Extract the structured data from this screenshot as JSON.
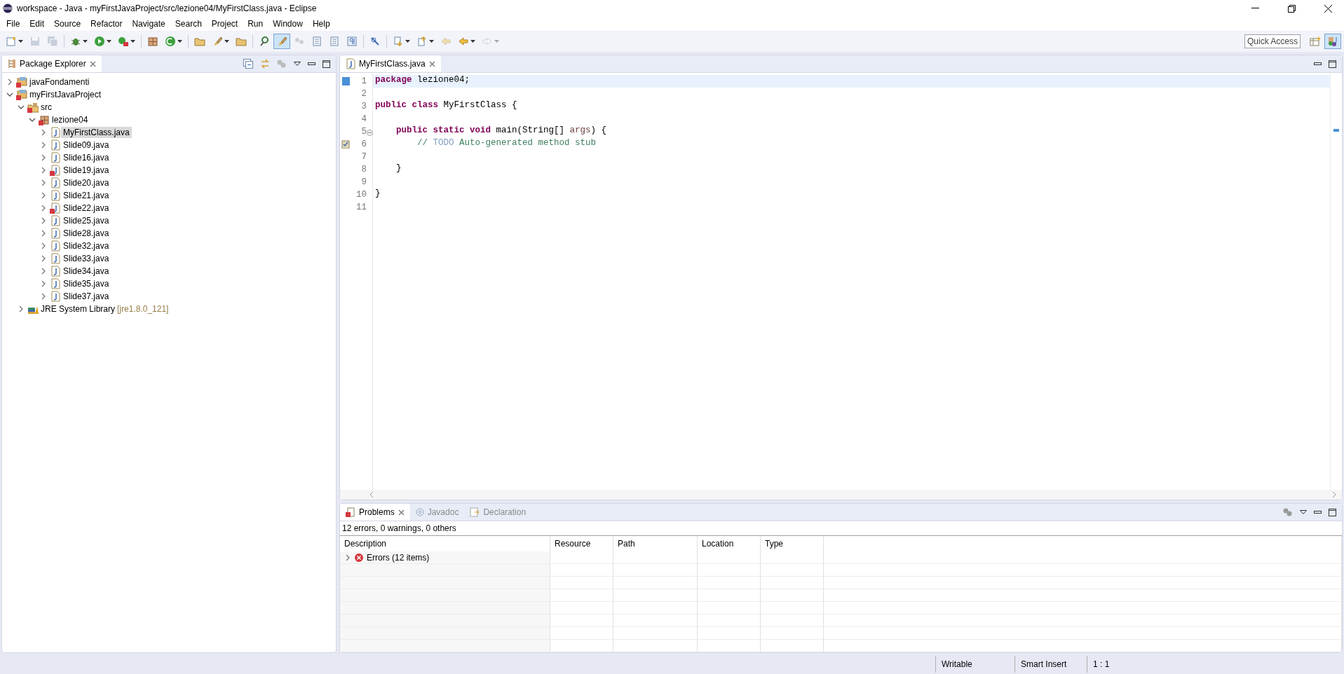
{
  "window": {
    "title": "workspace - Java - myFirstJavaProject/src/lezione04/MyFirstClass.java - Eclipse"
  },
  "menu": [
    "File",
    "Edit",
    "Source",
    "Refactor",
    "Navigate",
    "Search",
    "Project",
    "Run",
    "Window",
    "Help"
  ],
  "toolbar": [
    {
      "kind": "new",
      "dropdown": true,
      "selected": false,
      "disabled": false
    },
    {
      "kind": "save",
      "dropdown": false,
      "selected": false,
      "disabled": true
    },
    {
      "kind": "saveall",
      "dropdown": false,
      "selected": false,
      "disabled": true
    },
    {
      "kind": "sep"
    },
    {
      "kind": "bug",
      "dropdown": true,
      "selected": false,
      "disabled": false
    },
    {
      "kind": "run",
      "dropdown": true,
      "selected": false,
      "disabled": false
    },
    {
      "kind": "external",
      "dropdown": true,
      "selected": false,
      "disabled": false
    },
    {
      "kind": "sep"
    },
    {
      "kind": "package",
      "dropdown": false,
      "selected": false,
      "disabled": false
    },
    {
      "kind": "newclass",
      "dropdown": true,
      "selected": false,
      "disabled": false
    },
    {
      "kind": "sep"
    },
    {
      "kind": "folder",
      "dropdown": false,
      "selected": false,
      "disabled": false
    },
    {
      "kind": "brush",
      "dropdown": true,
      "selected": false,
      "disabled": false
    },
    {
      "kind": "folder",
      "dropdown": false,
      "selected": false,
      "disabled": false
    },
    {
      "kind": "sep"
    },
    {
      "kind": "search",
      "dropdown": false,
      "selected": false,
      "disabled": false
    },
    {
      "kind": "brush",
      "dropdown": false,
      "selected": true,
      "disabled": false
    },
    {
      "kind": "dots",
      "dropdown": false,
      "selected": false,
      "disabled": true
    },
    {
      "kind": "doc",
      "dropdown": false,
      "selected": false,
      "disabled": false
    },
    {
      "kind": "doc",
      "dropdown": false,
      "selected": false,
      "disabled": false
    },
    {
      "kind": "para",
      "dropdown": false,
      "selected": false,
      "disabled": false
    },
    {
      "kind": "sep"
    },
    {
      "kind": "pin",
      "dropdown": false,
      "selected": false,
      "disabled": false
    },
    {
      "kind": "sep"
    },
    {
      "kind": "down",
      "dropdown": true,
      "selected": false,
      "disabled": false
    },
    {
      "kind": "up",
      "dropdown": true,
      "selected": false,
      "disabled": false
    },
    {
      "kind": "back",
      "dropdown": false,
      "selected": false,
      "disabled": true
    },
    {
      "kind": "back",
      "dropdown": true,
      "selected": false,
      "disabled": false
    },
    {
      "kind": "forward",
      "dropdown": true,
      "selected": false,
      "disabled": true
    }
  ],
  "quick_access": {
    "placeholder": "Quick Access"
  },
  "perspectives": [
    {
      "kind": "open",
      "selected": false
    },
    {
      "kind": "java",
      "selected": true
    }
  ],
  "package_explorer": {
    "title": "Package Explorer",
    "tree": [
      {
        "kind": "project",
        "label": "javaFondamenti",
        "error": true,
        "expanded": false,
        "selected": false
      },
      {
        "kind": "project",
        "label": "myFirstJavaProject",
        "error": true,
        "expanded": true,
        "selected": false,
        "children": [
          {
            "kind": "folder",
            "label": "src",
            "error": true,
            "expanded": true,
            "selected": false,
            "children": [
              {
                "kind": "package",
                "label": "lezione04",
                "error": true,
                "expanded": true,
                "selected": false,
                "children": [
                  {
                    "kind": "file",
                    "label": "MyFirstClass.java",
                    "error": false,
                    "expanded": false,
                    "selected": true
                  },
                  {
                    "kind": "file",
                    "label": "Slide09.java",
                    "error": false,
                    "expanded": false,
                    "selected": false
                  },
                  {
                    "kind": "file",
                    "label": "Slide16.java",
                    "error": false,
                    "expanded": false,
                    "selected": false
                  },
                  {
                    "kind": "file",
                    "label": "Slide19.java",
                    "error": true,
                    "expanded": false,
                    "selected": false
                  },
                  {
                    "kind": "file",
                    "label": "Slide20.java",
                    "error": false,
                    "expanded": false,
                    "selected": false
                  },
                  {
                    "kind": "file",
                    "label": "Slide21.java",
                    "error": false,
                    "expanded": false,
                    "selected": false
                  },
                  {
                    "kind": "file",
                    "label": "Slide22.java",
                    "error": true,
                    "expanded": false,
                    "selected": false
                  },
                  {
                    "kind": "file",
                    "label": "Slide25.java",
                    "error": false,
                    "expanded": false,
                    "selected": false
                  },
                  {
                    "kind": "file",
                    "label": "Slide28.java",
                    "error": false,
                    "expanded": false,
                    "selected": false
                  },
                  {
                    "kind": "file",
                    "label": "Slide32.java",
                    "error": false,
                    "expanded": false,
                    "selected": false
                  },
                  {
                    "kind": "file",
                    "label": "Slide33.java",
                    "error": false,
                    "expanded": false,
                    "selected": false
                  },
                  {
                    "kind": "file",
                    "label": "Slide34.java",
                    "error": false,
                    "expanded": false,
                    "selected": false
                  },
                  {
                    "kind": "file",
                    "label": "Slide35.java",
                    "error": false,
                    "expanded": false,
                    "selected": false
                  },
                  {
                    "kind": "file",
                    "label": "Slide37.java",
                    "error": false,
                    "expanded": false,
                    "selected": false
                  }
                ]
              }
            ]
          },
          {
            "kind": "library",
            "label": "JRE System Library",
            "decoration": "[jre1.8.0_121]",
            "error": false,
            "expanded": false,
            "selected": false
          }
        ]
      }
    ]
  },
  "editor": {
    "tab": "MyFirstClass.java",
    "lines": [
      {
        "number": "1",
        "bookmark": true,
        "task": false,
        "foldable": false,
        "current": true,
        "tokens": [
          {
            "kind": "keyword",
            "text": "package"
          },
          {
            "kind": "plain",
            "text": " lezione04;"
          }
        ]
      },
      {
        "number": "2",
        "bookmark": false,
        "task": false,
        "foldable": false,
        "current": false
      },
      {
        "number": "3",
        "bookmark": false,
        "task": false,
        "foldable": false,
        "current": false,
        "tokens": [
          {
            "kind": "keyword",
            "text": "public"
          },
          {
            "kind": "keyword",
            "text": " class"
          },
          {
            "kind": "plain",
            "text": " MyFirstClass {"
          }
        ]
      },
      {
        "number": "4",
        "bookmark": false,
        "task": false,
        "foldable": false,
        "current": false
      },
      {
        "number": "5",
        "bookmark": false,
        "task": false,
        "foldable": true,
        "current": false,
        "tokens": [
          {
            "kind": "keyword",
            "text": "    public"
          },
          {
            "kind": "keyword",
            "text": " static"
          },
          {
            "kind": "keyword",
            "text": " void"
          },
          {
            "kind": "plain",
            "text": " main(String[] "
          },
          {
            "kind": "param",
            "text": "args"
          },
          {
            "kind": "plain",
            "text": ") {"
          }
        ]
      },
      {
        "number": "6",
        "bookmark": false,
        "task": true,
        "foldable": false,
        "current": false,
        "tokens": [
          {
            "kind": "comment",
            "text": "        // "
          },
          {
            "kind": "todo",
            "text": "TODO"
          },
          {
            "kind": "comment",
            "text": " Auto-generated method stub"
          }
        ]
      },
      {
        "number": "7",
        "bookmark": false,
        "task": false,
        "foldable": false,
        "current": false
      },
      {
        "number": "8",
        "bookmark": false,
        "task": false,
        "foldable": false,
        "current": false,
        "tokens": [
          {
            "kind": "plain",
            "text": "    }"
          }
        ]
      },
      {
        "number": "9",
        "bookmark": false,
        "task": false,
        "foldable": false,
        "current": false
      },
      {
        "number": "10",
        "bookmark": false,
        "task": false,
        "foldable": false,
        "current": false,
        "tokens": [
          {
            "kind": "plain",
            "text": "}"
          }
        ]
      },
      {
        "number": "11",
        "bookmark": false,
        "task": false,
        "foldable": false,
        "current": false
      }
    ]
  },
  "bottom_tabs": [
    {
      "kind": "problems",
      "label": "Problems",
      "selected": true
    },
    {
      "kind": "javadoc",
      "label": "Javadoc",
      "selected": false
    },
    {
      "kind": "declaration",
      "label": "Declaration",
      "selected": false
    }
  ],
  "problems": {
    "summary": "12 errors, 0 warnings, 0 others",
    "columns": [
      "Description",
      "Resource",
      "Path",
      "Location",
      "Type"
    ],
    "rows": [
      {
        "label": "Errors (12 items)",
        "expanded": false
      }
    ]
  },
  "status_bar": [
    "Writable",
    "Smart Insert",
    "1 : 1"
  ]
}
